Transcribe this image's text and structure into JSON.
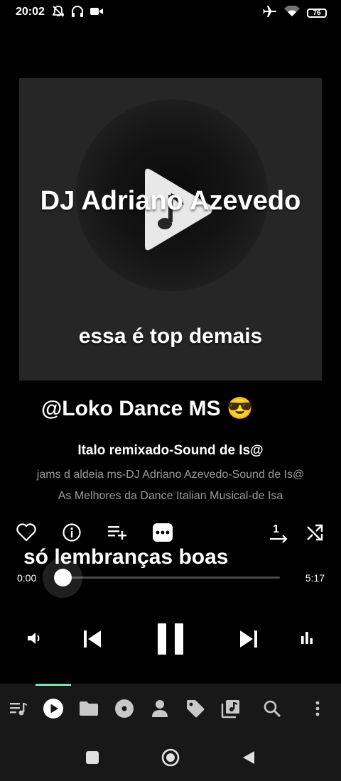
{
  "status_bar": {
    "time": "20:02",
    "battery": "76",
    "icons": [
      "mute-icon",
      "headphones-icon",
      "video-camera-icon",
      "airplane-icon",
      "wifi-icon",
      "battery-icon"
    ]
  },
  "artwork": {
    "title": "DJ Adriano Azevedo",
    "subtitle": "essa é top demais"
  },
  "overlay": {
    "handle": "@Loko Dance MS 😎",
    "caption": "só lembranças boas"
  },
  "track": {
    "title": "Italo remixado-Sound de Is@",
    "artist": "jams d aldeia ms-DJ Adriano Azevedo-Sound de Is@",
    "album": "As Melhores da Dance Italian Musical-de Isa"
  },
  "actions": [
    "heart-icon",
    "info-icon",
    "add-to-playlist-icon",
    "more-icon",
    "repeat-one-icon",
    "shuffle-icon"
  ],
  "progress": {
    "current": "0:00",
    "total": "5:17",
    "fraction": 0
  },
  "transport": [
    "volume-icon",
    "previous-icon",
    "pause-icon",
    "next-icon",
    "equalizer-icon"
  ],
  "bottom_nav": {
    "items": [
      "queue-icon",
      "now-playing-icon",
      "folder-icon",
      "album-icon",
      "artist-icon",
      "tag-icon",
      "library-icon",
      "search-icon",
      "overflow-icon"
    ],
    "active": "now-playing-icon",
    "accent_color": "#7de0b5"
  },
  "system_nav": [
    "recents-button",
    "home-button",
    "back-button"
  ]
}
